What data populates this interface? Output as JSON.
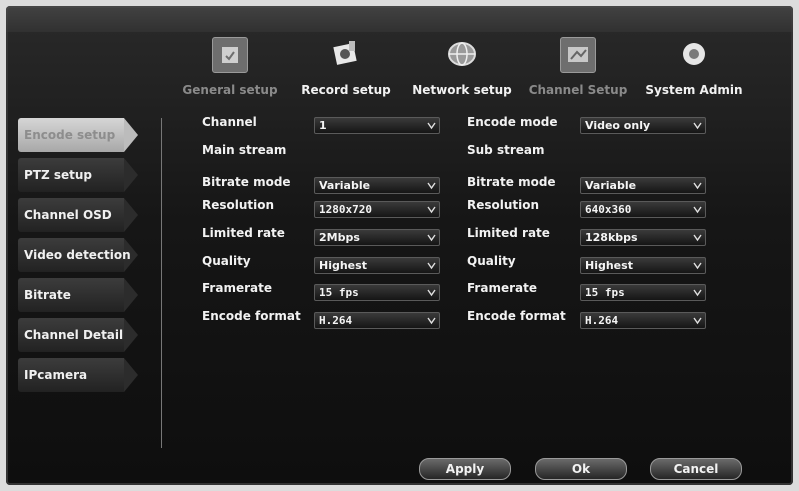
{
  "top_tabs": [
    {
      "label": "General setup",
      "icon": "general-setup-icon"
    },
    {
      "label": "Record setup",
      "icon": "record-setup-icon"
    },
    {
      "label": "Network setup",
      "icon": "network-setup-icon"
    },
    {
      "label": "Channel Setup",
      "icon": "channel-setup-icon"
    },
    {
      "label": "System Admin",
      "icon": "system-admin-icon"
    }
  ],
  "sidebar": {
    "items": [
      {
        "label": "Encode setup"
      },
      {
        "label": "PTZ setup"
      },
      {
        "label": "Channel OSD"
      },
      {
        "label": "Video detection"
      },
      {
        "label": "Bitrate"
      },
      {
        "label": "Channel Detail"
      },
      {
        "label": "IPcamera"
      }
    ]
  },
  "form": {
    "channel": {
      "label": "Channel",
      "value": "1"
    },
    "encode_mode": {
      "label": "Encode mode",
      "value": "Video only"
    },
    "main_stream": {
      "title": "Main stream",
      "fields": [
        {
          "label": "Bitrate mode",
          "value": "Variable"
        },
        {
          "label": "Resolution",
          "value": "1280x720"
        },
        {
          "label": "Limited rate",
          "value": "2Mbps"
        },
        {
          "label": "Quality",
          "value": "Highest"
        },
        {
          "label": "Framerate",
          "value": "15 fps"
        },
        {
          "label": "Encode format",
          "value": "H.264"
        }
      ]
    },
    "sub_stream": {
      "title": "Sub stream",
      "fields": [
        {
          "label": "Bitrate mode",
          "value": "Variable"
        },
        {
          "label": "Resolution",
          "value": "640x360"
        },
        {
          "label": "Limited rate",
          "value": "128kbps"
        },
        {
          "label": "Quality",
          "value": "Highest"
        },
        {
          "label": "Framerate",
          "value": "15 fps"
        },
        {
          "label": "Encode format",
          "value": "H.264"
        }
      ]
    }
  },
  "buttons": {
    "apply": "Apply",
    "ok": "Ok",
    "cancel": "Cancel"
  }
}
